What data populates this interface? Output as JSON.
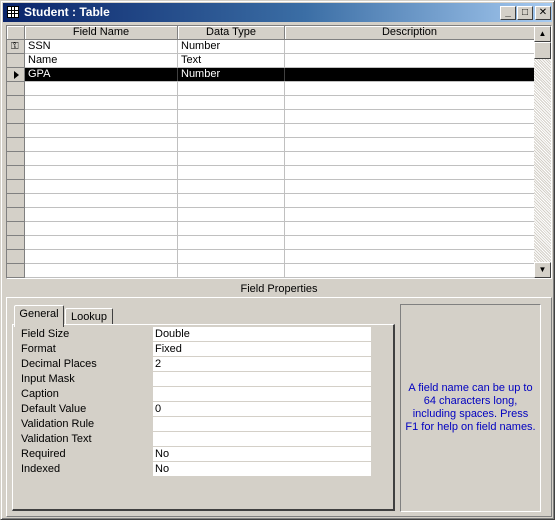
{
  "window": {
    "title": "Student : Table",
    "minimize_glyph": "_",
    "maximize_glyph": "□",
    "close_glyph": "✕"
  },
  "grid": {
    "columns": [
      "Field Name",
      "Data Type",
      "Description"
    ],
    "rows": [
      {
        "field_name": "SSN",
        "data_type": "Number",
        "description": "",
        "primary_key": true
      },
      {
        "field_name": "Name",
        "data_type": "Text",
        "description": ""
      },
      {
        "field_name": "GPA",
        "data_type": "Number",
        "description": "",
        "selected": true
      }
    ]
  },
  "field_properties": {
    "heading": "Field Properties",
    "tabs": [
      "General",
      "Lookup"
    ],
    "active_tab": "General",
    "properties": [
      {
        "label": "Field Size",
        "value": "Double"
      },
      {
        "label": "Format",
        "value": "Fixed"
      },
      {
        "label": "Decimal Places",
        "value": "2"
      },
      {
        "label": "Input Mask",
        "value": ""
      },
      {
        "label": "Caption",
        "value": ""
      },
      {
        "label": "Default Value",
        "value": "0"
      },
      {
        "label": "Validation Rule",
        "value": ""
      },
      {
        "label": "Validation Text",
        "value": ""
      },
      {
        "label": "Required",
        "value": "No"
      },
      {
        "label": "Indexed",
        "value": "No"
      }
    ],
    "help_text": "A field name can be up to 64 characters long, including spaces.  Press F1 for help on field names."
  },
  "icons": {
    "title": "table-icon",
    "primary_key": "key-icon",
    "row_selector": "current-row-arrow-icon",
    "scroll_up": "arrow-up-icon",
    "scroll_down": "arrow-down-icon"
  },
  "colors": {
    "title_bar": "#0a246a",
    "help_text": "#0000c0",
    "selected_row": "#000000"
  }
}
